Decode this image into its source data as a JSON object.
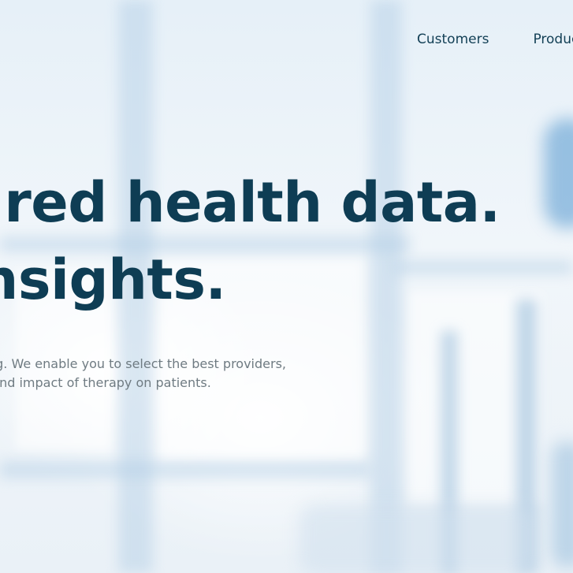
{
  "nav": {
    "items": [
      {
        "label": "Customers"
      },
      {
        "label": "Produc"
      }
    ]
  },
  "hero": {
    "headline_line1": "ctured health data.",
    "headline_line2": "insights.",
    "sub_line1": "gh the fog. We enable you to select the best providers,",
    "sub_line2": "se and impact of therapy on patients."
  },
  "colors": {
    "headline": "#0e3d54",
    "nav": "#123f55",
    "body_text": "#6f7b82"
  }
}
